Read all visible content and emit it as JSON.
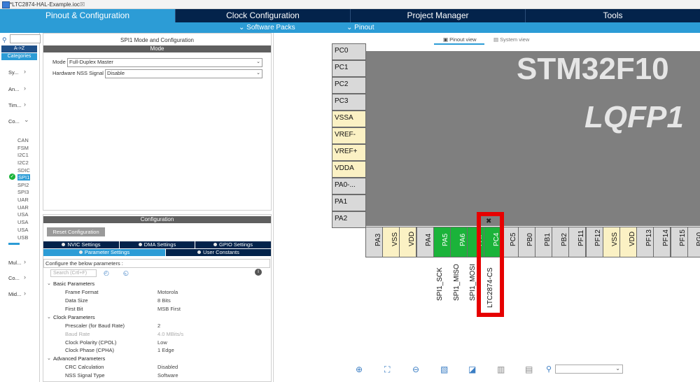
{
  "window": {
    "title": "*LTC2874-HAL-Example.ioc"
  },
  "main_tabs": [
    {
      "label": "Pinout & Configuration"
    },
    {
      "label": "Clock Configuration"
    },
    {
      "label": "Project Manager"
    },
    {
      "label": "Tools"
    }
  ],
  "subbar": {
    "software_packs": "Software Packs",
    "pinout": "Pinout"
  },
  "left_panel": {
    "toggle_az": "A->Z",
    "toggle_categories": "Categories",
    "categories": [
      "Sy...",
      "An...",
      "Tim...",
      "Co...",
      "Mul...",
      "Co...",
      "Mid..."
    ],
    "peripherals": [
      "CAN",
      "FSM",
      "I2C1",
      "I2C2",
      "SDIC",
      "SPI1",
      "SPI2",
      "SPI3",
      "UAR",
      "UAR",
      "USA",
      "USA",
      "USA",
      "USB"
    ]
  },
  "mode_panel": {
    "title": "SPI1 Mode and Configuration",
    "header": "Mode",
    "mode_label": "Mode",
    "mode_value": "Full-Duplex Master",
    "nss_label": "Hardware NSS Signal",
    "nss_value": "Disable"
  },
  "config_panel": {
    "header": "Configuration",
    "reset_button": "Reset Configuration",
    "tabs_row1": [
      "NVIC Settings",
      "DMA Settings",
      "GPIO Settings"
    ],
    "tabs_row2": [
      "Parameter Settings",
      "User Constants"
    ],
    "configure_text": "Configure the below parameters :",
    "search_placeholder": "Search (Crtl+F)",
    "groups": [
      {
        "name": "Basic Parameters",
        "rows": [
          {
            "label": "Frame Format",
            "value": "Motorola"
          },
          {
            "label": "Data Size",
            "value": "8 Bits"
          },
          {
            "label": "First Bit",
            "value": "MSB First"
          }
        ]
      },
      {
        "name": "Clock Parameters",
        "rows": [
          {
            "label": "Prescaler (for Baud Rate)",
            "value": "2"
          },
          {
            "label": "Baud Rate",
            "value": "4.0 MBits/s"
          },
          {
            "label": "Clock Polarity (CPOL)",
            "value": "Low"
          },
          {
            "label": "Clock Phase (CPHA)",
            "value": "1 Edge"
          }
        ]
      },
      {
        "name": "Advanced Parameters",
        "rows": [
          {
            "label": "CRC Calculation",
            "value": "Disabled"
          },
          {
            "label": "NSS Signal Type",
            "value": "Software"
          }
        ]
      }
    ]
  },
  "pinout_view": {
    "tab_pinout": "Pinout view",
    "tab_system": "System view",
    "chip_name": "STM32F10",
    "chip_package": "LQFP1",
    "left_pins": [
      {
        "label": "PC0",
        "color": "#d9d9d9"
      },
      {
        "label": "PC1",
        "color": "#d9d9d9"
      },
      {
        "label": "PC2",
        "color": "#d9d9d9"
      },
      {
        "label": "PC3",
        "color": "#d9d9d9"
      },
      {
        "label": "VSSA",
        "color": "#fbf1c4"
      },
      {
        "label": "VREF-",
        "color": "#fbf1c4"
      },
      {
        "label": "VREF+",
        "color": "#fbf1c4"
      },
      {
        "label": "VDDA",
        "color": "#fbf1c4"
      },
      {
        "label": "PA0-...",
        "color": "#d9d9d9"
      },
      {
        "label": "PA1",
        "color": "#d9d9d9"
      },
      {
        "label": "PA2",
        "color": "#d9d9d9"
      }
    ],
    "bottom_pins": [
      {
        "label": "PA3",
        "color": "#d9d9d9"
      },
      {
        "label": "VSS",
        "color": "#fbf1c4"
      },
      {
        "label": "VDD",
        "color": "#fbf1c4"
      },
      {
        "label": "PA4",
        "color": "#d9d9d9"
      },
      {
        "label": "PA5",
        "color": "#1bb33a"
      },
      {
        "label": "PA6",
        "color": "#1bb33a"
      },
      {
        "label": "PA7",
        "color": "#1bb33a"
      },
      {
        "label": "PC4",
        "color": "#1bb33a"
      },
      {
        "label": "PC5",
        "color": "#d9d9d9"
      },
      {
        "label": "PB0",
        "color": "#d9d9d9"
      },
      {
        "label": "PB1",
        "color": "#d9d9d9"
      },
      {
        "label": "PB2",
        "color": "#d9d9d9"
      },
      {
        "label": "PF11",
        "color": "#d9d9d9"
      },
      {
        "label": "PF12",
        "color": "#d9d9d9"
      },
      {
        "label": "VSS",
        "color": "#fbf1c4"
      },
      {
        "label": "VDD",
        "color": "#fbf1c4"
      },
      {
        "label": "PF13",
        "color": "#d9d9d9"
      },
      {
        "label": "PF14",
        "color": "#d9d9d9"
      },
      {
        "label": "PF15",
        "color": "#d9d9d9"
      },
      {
        "label": "PG0",
        "color": "#d9d9d9"
      }
    ],
    "signal_labels": [
      "SPI1_SCK",
      "SPI1_MISO",
      "SPI1_MOSI",
      "LTC2874-CS"
    ]
  },
  "colors": {
    "nav_dark": "#03234b",
    "accent": "#2c9cd6",
    "pin_green": "#1bb33a",
    "highlight": "#e60000"
  }
}
